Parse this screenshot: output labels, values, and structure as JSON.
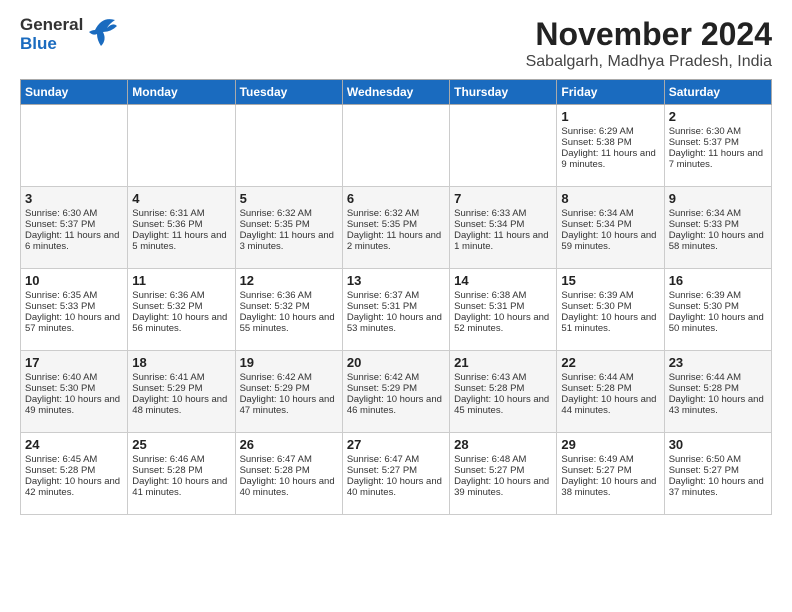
{
  "logo": {
    "line1": "General",
    "line2": "Blue"
  },
  "title": "November 2024",
  "location": "Sabalgarh, Madhya Pradesh, India",
  "weekdays": [
    "Sunday",
    "Monday",
    "Tuesday",
    "Wednesday",
    "Thursday",
    "Friday",
    "Saturday"
  ],
  "weeks": [
    [
      {
        "day": "",
        "text": ""
      },
      {
        "day": "",
        "text": ""
      },
      {
        "day": "",
        "text": ""
      },
      {
        "day": "",
        "text": ""
      },
      {
        "day": "",
        "text": ""
      },
      {
        "day": "1",
        "text": "Sunrise: 6:29 AM\nSunset: 5:38 PM\nDaylight: 11 hours and 9 minutes."
      },
      {
        "day": "2",
        "text": "Sunrise: 6:30 AM\nSunset: 5:37 PM\nDaylight: 11 hours and 7 minutes."
      }
    ],
    [
      {
        "day": "3",
        "text": "Sunrise: 6:30 AM\nSunset: 5:37 PM\nDaylight: 11 hours and 6 minutes."
      },
      {
        "day": "4",
        "text": "Sunrise: 6:31 AM\nSunset: 5:36 PM\nDaylight: 11 hours and 5 minutes."
      },
      {
        "day": "5",
        "text": "Sunrise: 6:32 AM\nSunset: 5:35 PM\nDaylight: 11 hours and 3 minutes."
      },
      {
        "day": "6",
        "text": "Sunrise: 6:32 AM\nSunset: 5:35 PM\nDaylight: 11 hours and 2 minutes."
      },
      {
        "day": "7",
        "text": "Sunrise: 6:33 AM\nSunset: 5:34 PM\nDaylight: 11 hours and 1 minute."
      },
      {
        "day": "8",
        "text": "Sunrise: 6:34 AM\nSunset: 5:34 PM\nDaylight: 10 hours and 59 minutes."
      },
      {
        "day": "9",
        "text": "Sunrise: 6:34 AM\nSunset: 5:33 PM\nDaylight: 10 hours and 58 minutes."
      }
    ],
    [
      {
        "day": "10",
        "text": "Sunrise: 6:35 AM\nSunset: 5:33 PM\nDaylight: 10 hours and 57 minutes."
      },
      {
        "day": "11",
        "text": "Sunrise: 6:36 AM\nSunset: 5:32 PM\nDaylight: 10 hours and 56 minutes."
      },
      {
        "day": "12",
        "text": "Sunrise: 6:36 AM\nSunset: 5:32 PM\nDaylight: 10 hours and 55 minutes."
      },
      {
        "day": "13",
        "text": "Sunrise: 6:37 AM\nSunset: 5:31 PM\nDaylight: 10 hours and 53 minutes."
      },
      {
        "day": "14",
        "text": "Sunrise: 6:38 AM\nSunset: 5:31 PM\nDaylight: 10 hours and 52 minutes."
      },
      {
        "day": "15",
        "text": "Sunrise: 6:39 AM\nSunset: 5:30 PM\nDaylight: 10 hours and 51 minutes."
      },
      {
        "day": "16",
        "text": "Sunrise: 6:39 AM\nSunset: 5:30 PM\nDaylight: 10 hours and 50 minutes."
      }
    ],
    [
      {
        "day": "17",
        "text": "Sunrise: 6:40 AM\nSunset: 5:30 PM\nDaylight: 10 hours and 49 minutes."
      },
      {
        "day": "18",
        "text": "Sunrise: 6:41 AM\nSunset: 5:29 PM\nDaylight: 10 hours and 48 minutes."
      },
      {
        "day": "19",
        "text": "Sunrise: 6:42 AM\nSunset: 5:29 PM\nDaylight: 10 hours and 47 minutes."
      },
      {
        "day": "20",
        "text": "Sunrise: 6:42 AM\nSunset: 5:29 PM\nDaylight: 10 hours and 46 minutes."
      },
      {
        "day": "21",
        "text": "Sunrise: 6:43 AM\nSunset: 5:28 PM\nDaylight: 10 hours and 45 minutes."
      },
      {
        "day": "22",
        "text": "Sunrise: 6:44 AM\nSunset: 5:28 PM\nDaylight: 10 hours and 44 minutes."
      },
      {
        "day": "23",
        "text": "Sunrise: 6:44 AM\nSunset: 5:28 PM\nDaylight: 10 hours and 43 minutes."
      }
    ],
    [
      {
        "day": "24",
        "text": "Sunrise: 6:45 AM\nSunset: 5:28 PM\nDaylight: 10 hours and 42 minutes."
      },
      {
        "day": "25",
        "text": "Sunrise: 6:46 AM\nSunset: 5:28 PM\nDaylight: 10 hours and 41 minutes."
      },
      {
        "day": "26",
        "text": "Sunrise: 6:47 AM\nSunset: 5:28 PM\nDaylight: 10 hours and 40 minutes."
      },
      {
        "day": "27",
        "text": "Sunrise: 6:47 AM\nSunset: 5:27 PM\nDaylight: 10 hours and 40 minutes."
      },
      {
        "day": "28",
        "text": "Sunrise: 6:48 AM\nSunset: 5:27 PM\nDaylight: 10 hours and 39 minutes."
      },
      {
        "day": "29",
        "text": "Sunrise: 6:49 AM\nSunset: 5:27 PM\nDaylight: 10 hours and 38 minutes."
      },
      {
        "day": "30",
        "text": "Sunrise: 6:50 AM\nSunset: 5:27 PM\nDaylight: 10 hours and 37 minutes."
      }
    ]
  ]
}
